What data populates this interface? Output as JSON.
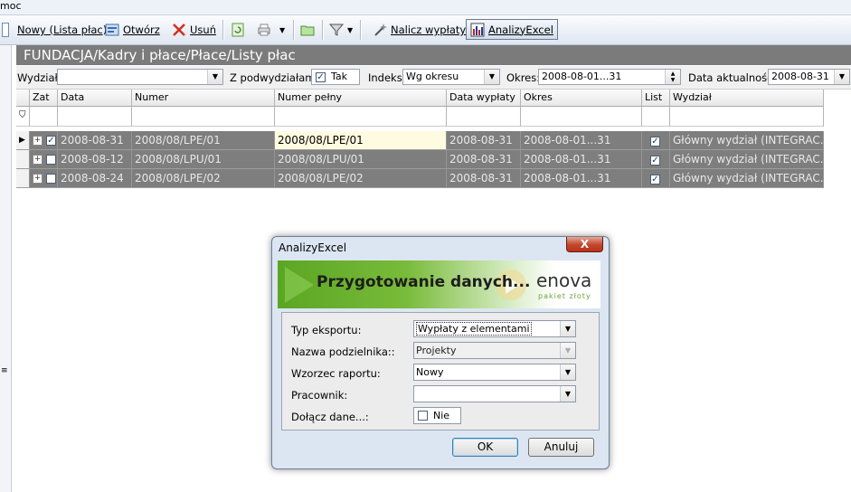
{
  "menu": {
    "partial_label": "moc"
  },
  "toolbar": {
    "new_label": "Nowy (Lista płac)",
    "open_label": "Otwórz",
    "delete_label": "Usuń",
    "calc_label": "Nalicz wypłaty",
    "analyzy_label": "AnalizyExcel",
    "dropdown_glyph": "▼"
  },
  "path": "FUNDACJA/Kadry i płace/Płace/Listy płac",
  "filter": {
    "dept_label": "Wydział:",
    "dept_value": "",
    "sub_label": "Z podwydziałami:",
    "sub_value": "Tak",
    "index_label": "Indeks:",
    "index_value": "Wg okresu",
    "period_label": "Okres:",
    "period_value": "2008-08-01...31",
    "actual_label": "Data aktualności:",
    "actual_value": "2008-08-31"
  },
  "grid": {
    "columns": [
      "Zat",
      "Data",
      "Numer",
      "Numer pełny",
      "Data wypłaty",
      "Okres",
      "List",
      "Wydział"
    ],
    "rows": [
      {
        "zat": true,
        "data": "2008-08-31",
        "numer": "2008/08/LPE/01",
        "pelny": "2008/08/LPE/01",
        "wyplata": "2008-08-31",
        "okres": "2008-08-01...31",
        "list": true,
        "wydzial": "Główny wydział (INTEGRAC..."
      },
      {
        "zat": false,
        "data": "2008-08-12",
        "numer": "2008/08/LPU/01",
        "pelny": "2008/08/LPU/01",
        "wyplata": "2008-08-31",
        "okres": "2008-08-01...31",
        "list": true,
        "wydzial": "Główny wydział (INTEGRAC..."
      },
      {
        "zat": false,
        "data": "2008-08-24",
        "numer": "2008/08/LPE/02",
        "pelny": "2008/08/LPE/02",
        "wyplata": "2008-08-31",
        "okres": "2008-08-01...31",
        "list": true,
        "wydzial": "Główny wydział (INTEGRAC..."
      }
    ]
  },
  "dialog": {
    "title": "AnalizyExcel",
    "close_glyph": "X",
    "banner": "Przygotowanie danych...",
    "logo": "enova",
    "logo_sub": "pakiet złoty",
    "fields": {
      "typ_label": "Typ eksportu:",
      "typ_value": "Wypłaty z elementami",
      "podz_label": "Nazwa podzielnika::",
      "podz_value": "Projekty",
      "wzor_label": "Wzorzec raportu:",
      "wzor_value": "Nowy",
      "prac_label": "Pracownik:",
      "prac_value": "",
      "dolacz_label": "Dołącz dane...:",
      "dolacz_value": "Nie"
    },
    "ok_label": "OK",
    "cancel_label": "Anuluj"
  },
  "colors": {
    "grid_row": "#7e7e7e",
    "selected_cell": "#fffbe0",
    "title_bar": "#7b7b7b",
    "banner_green": "#5aa622"
  }
}
